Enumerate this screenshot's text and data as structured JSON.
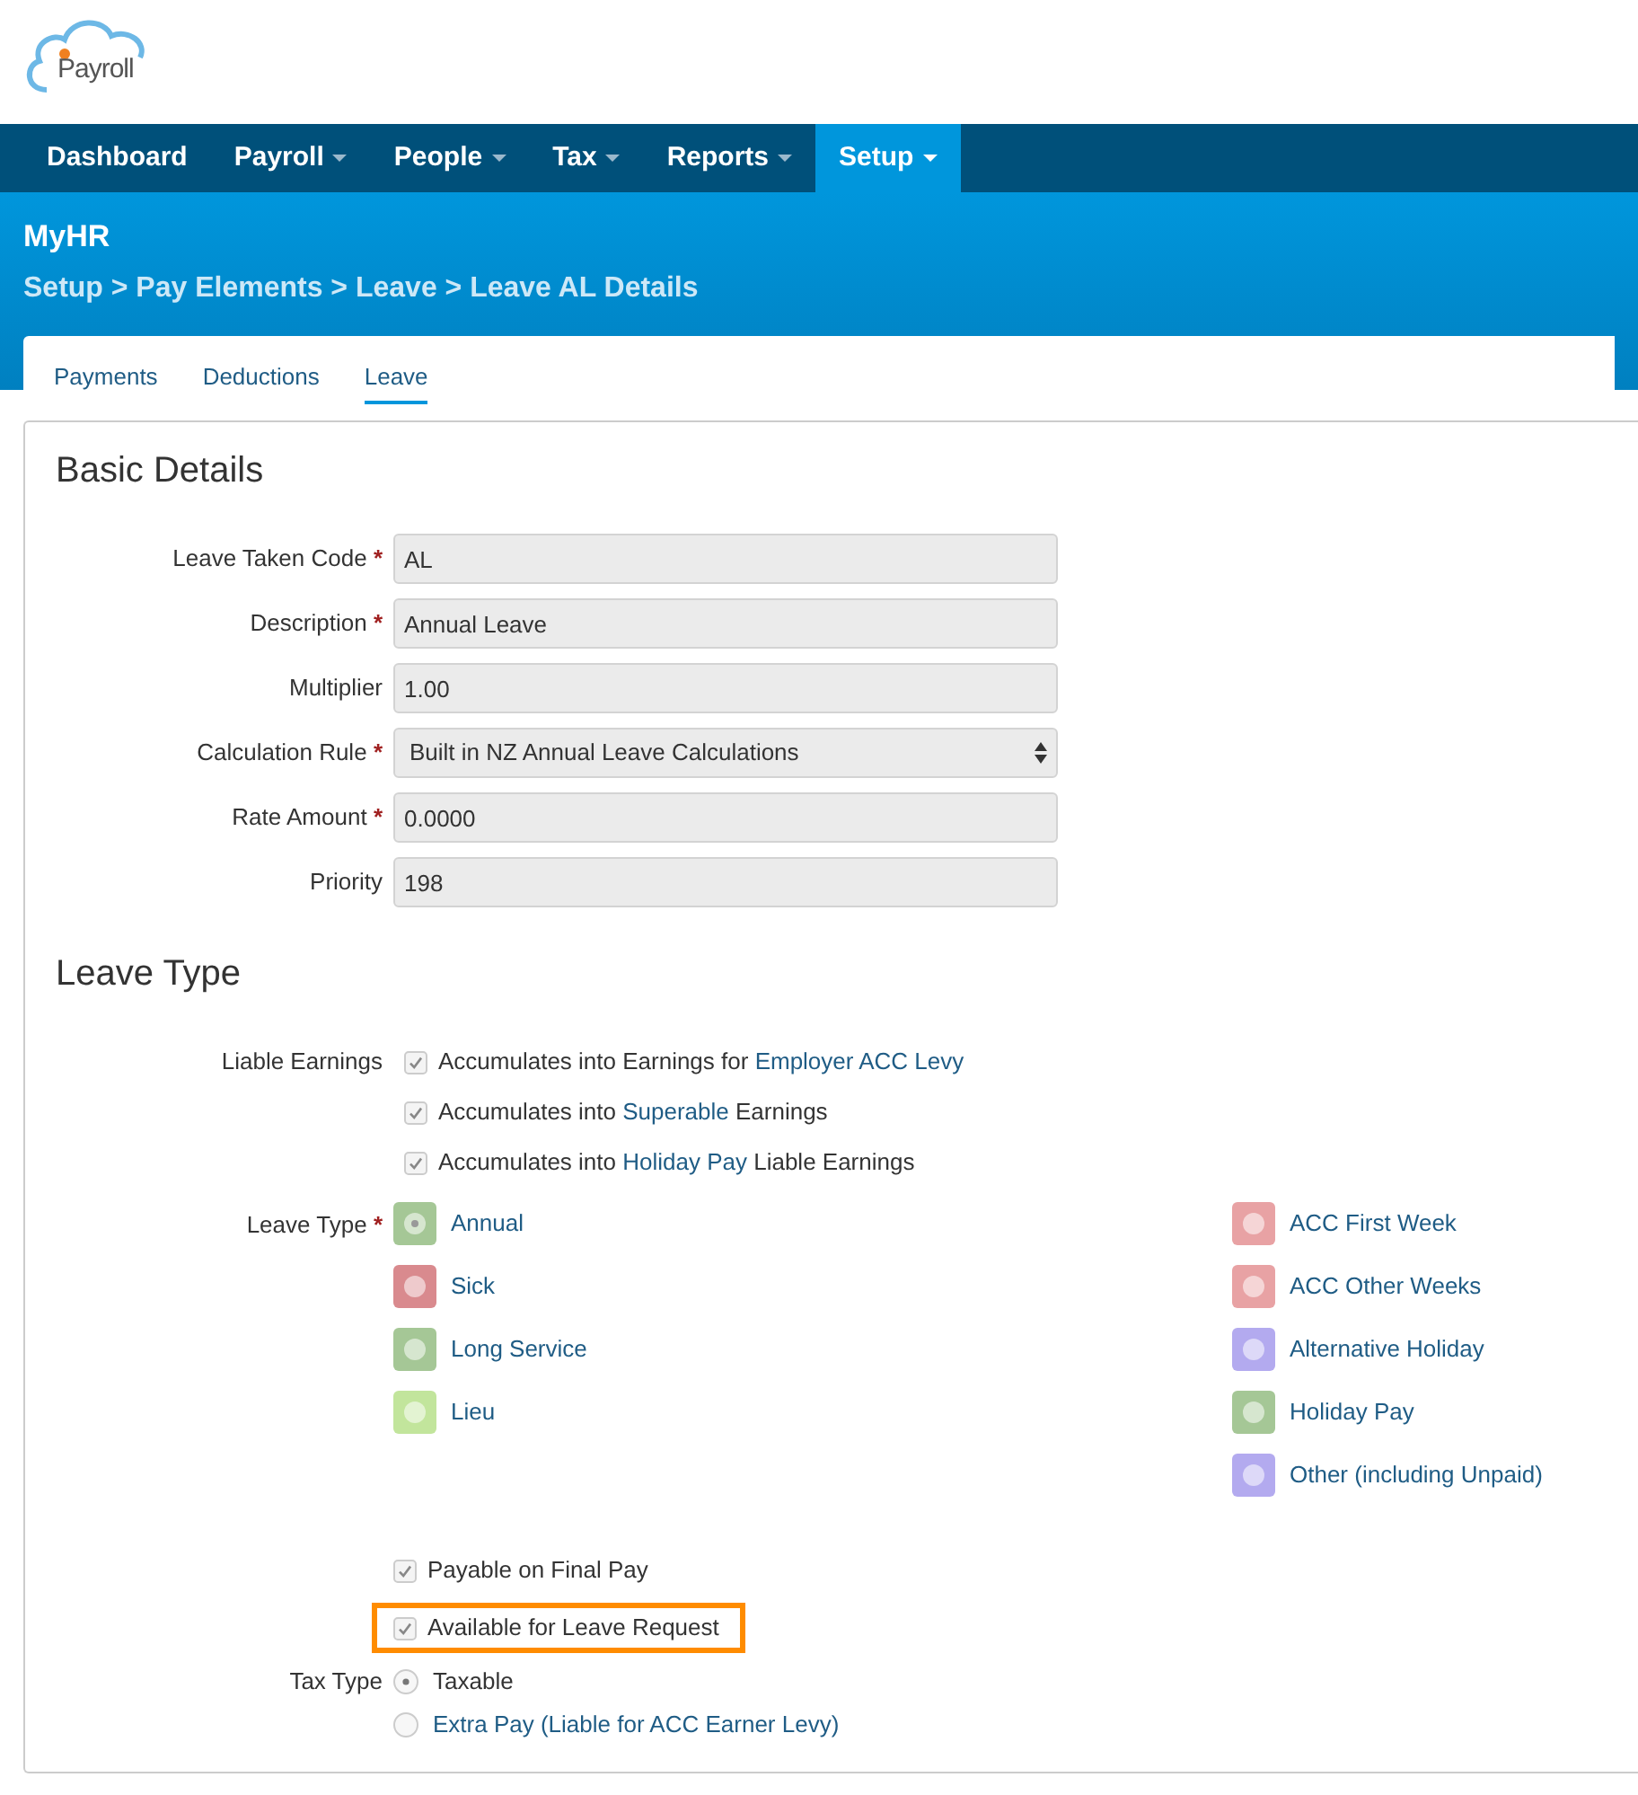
{
  "logo": {
    "text": "Payroll"
  },
  "nav": [
    {
      "label": "Dashboard",
      "dropdown": false,
      "selected": false
    },
    {
      "label": "Payroll",
      "dropdown": true,
      "selected": false
    },
    {
      "label": "People",
      "dropdown": true,
      "selected": false
    },
    {
      "label": "Tax",
      "dropdown": true,
      "selected": false
    },
    {
      "label": "Reports",
      "dropdown": true,
      "selected": false
    },
    {
      "label": "Setup",
      "dropdown": true,
      "selected": true
    }
  ],
  "header": {
    "title": "MyHR",
    "breadcrumb": "Setup > Pay Elements > Leave > Leave AL Details"
  },
  "tabs": [
    {
      "label": "Payments",
      "selected": false
    },
    {
      "label": "Deductions",
      "selected": false
    },
    {
      "label": "Leave",
      "selected": true
    }
  ],
  "basic_details": {
    "heading": "Basic Details",
    "fields": [
      {
        "label": "Leave Taken Code",
        "required_mark": "*",
        "kind": "text",
        "value": "AL"
      },
      {
        "label": "Description",
        "required_mark": "*",
        "kind": "text",
        "value": "Annual Leave"
      },
      {
        "label": "Multiplier",
        "kind": "text",
        "value": "1.00"
      },
      {
        "label": "Calculation Rule",
        "required_mark": "*",
        "kind": "select",
        "value": "Built in NZ Annual Leave Calculations"
      },
      {
        "label": "Rate Amount",
        "required_mark": "*",
        "kind": "text",
        "value": "0.0000"
      },
      {
        "label": "Priority",
        "kind": "text",
        "value": "198"
      }
    ]
  },
  "leave_type_section": {
    "heading": "Leave Type",
    "liable_earnings": {
      "label": "Liable Earnings",
      "options": [
        {
          "checked": true,
          "parts": [
            {
              "text": "Accumulates into Earnings for ",
              "link": false
            },
            {
              "text": "Employer ACC Levy",
              "link": true
            }
          ]
        },
        {
          "checked": true,
          "parts": [
            {
              "text": "Accumulates into ",
              "link": false
            },
            {
              "text": "Superable",
              "link": true
            },
            {
              "text": " Earnings",
              "link": false
            }
          ]
        },
        {
          "checked": true,
          "parts": [
            {
              "text": "Accumulates into ",
              "link": false
            },
            {
              "text": "Holiday Pay",
              "link": true
            },
            {
              "text": " Liable Earnings",
              "link": false
            }
          ]
        }
      ]
    },
    "leave_type": {
      "label": "Leave Type",
      "required_mark": "*",
      "left_options": [
        {
          "label": "Annual",
          "color": "#a5c796",
          "selected": true
        },
        {
          "label": "Sick",
          "color": "#d98a8e",
          "selected": false
        },
        {
          "label": "Long Service",
          "color": "#a5c796",
          "selected": false
        },
        {
          "label": "Lieu",
          "color": "#c2e59c",
          "selected": false
        }
      ],
      "right_options": [
        {
          "label": "ACC First Week",
          "color": "#e8a2a4",
          "selected": false
        },
        {
          "label": "ACC Other Weeks",
          "color": "#e8a2a4",
          "selected": false
        },
        {
          "label": "Alternative Holiday",
          "color": "#b3aaef",
          "selected": false
        },
        {
          "label": "Holiday Pay",
          "color": "#a5c796",
          "selected": false
        },
        {
          "label": "Other (including Unpaid)",
          "color": "#b3aaef",
          "selected": false
        }
      ]
    },
    "flags": [
      {
        "label": "Payable on Final Pay",
        "checked": true,
        "highlighted": false
      },
      {
        "label": "Available for Leave Request",
        "checked": true,
        "highlighted": true
      }
    ],
    "tax_type": {
      "label": "Tax Type",
      "options": [
        {
          "label": "Taxable",
          "selected": true,
          "link": false
        },
        {
          "label": "Extra Pay (Liable for ACC Earner Levy)",
          "selected": false,
          "link": true
        }
      ]
    }
  }
}
